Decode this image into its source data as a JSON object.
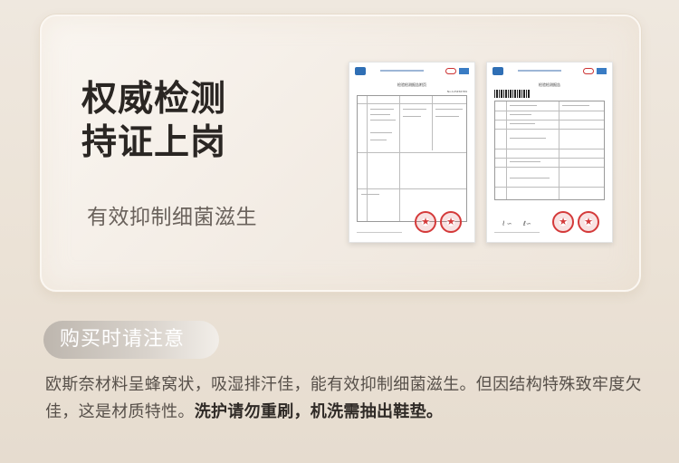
{
  "hero": {
    "headline_line1": "权威检测",
    "headline_line2": "持证上岗",
    "subline": "有效抑制细菌滋生"
  },
  "documents": {
    "left_title": "检验检测报告附页",
    "left_code": "No.123456789",
    "right_title": "检验检测报告"
  },
  "notice": {
    "badge": "购买时请注意",
    "text_normal": "欧斯奈材料呈蜂窝状，吸湿排汗佳，能有效抑制细菌滋生。但因结构特殊致牢度欠佳，这是材质特性。",
    "text_bold": "洗护请勿重刷，机洗需抽出鞋垫。"
  },
  "colors": {
    "stamp_red": "#d43a3a",
    "logo_blue": "#2f6fb5",
    "headline": "#2a2623"
  },
  "icons": [
    "cma-logo-icon",
    "cnas-logo-icon",
    "ilac-logo-icon",
    "red-seal-icon"
  ]
}
